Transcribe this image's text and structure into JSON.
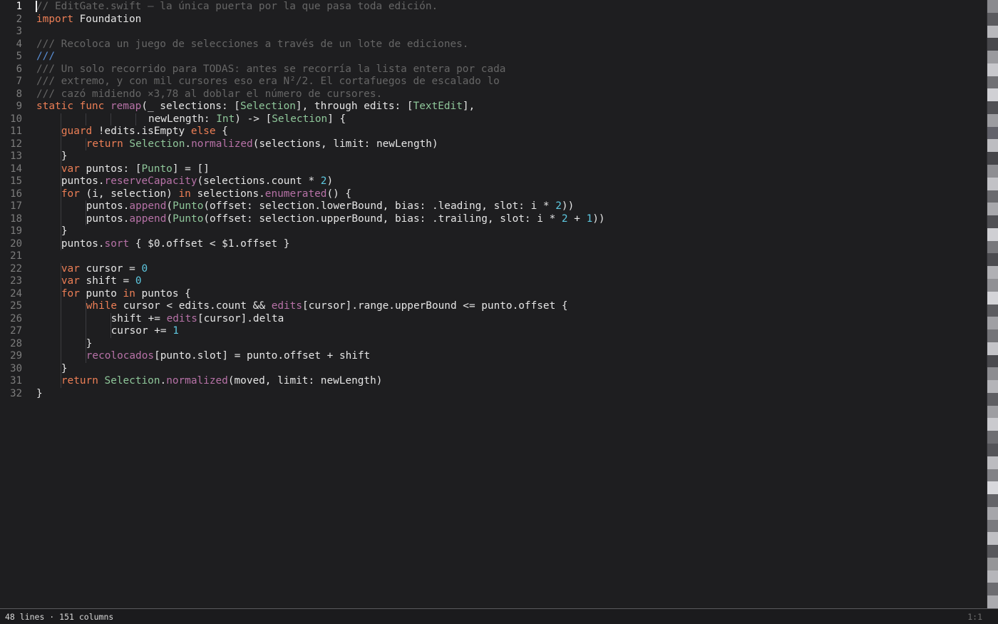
{
  "editor": {
    "current_line": 1,
    "lines": [
      {
        "n": "1",
        "indent": 0,
        "tokens": [
          [
            "cm",
            "// EditGate.swift — la única puerta por la que pasa toda edición."
          ]
        ]
      },
      {
        "n": "2",
        "indent": 0,
        "tokens": [
          [
            "kw",
            "import"
          ],
          [
            "pl",
            " Foundation"
          ]
        ]
      },
      {
        "n": "3",
        "indent": 0,
        "tokens": []
      },
      {
        "n": "4",
        "indent": 0,
        "tokens": [
          [
            "cm",
            "/// Recoloca un juego de selecciones a través de un lote de ediciones."
          ]
        ]
      },
      {
        "n": "5",
        "indent": 0,
        "tokens": [
          [
            "dc",
            "///"
          ]
        ]
      },
      {
        "n": "6",
        "indent": 0,
        "tokens": [
          [
            "cm",
            "/// Un solo recorrido para TODAS: antes se recorría la lista entera por cada"
          ]
        ]
      },
      {
        "n": "7",
        "indent": 0,
        "tokens": [
          [
            "cm",
            "/// extremo, y con mil cursores eso era N²/2. El cortafuegos de escalado lo"
          ]
        ]
      },
      {
        "n": "8",
        "indent": 0,
        "tokens": [
          [
            "cm",
            "/// cazó midiendo ×3,78 al doblar el número de cursores."
          ]
        ]
      },
      {
        "n": "9",
        "indent": 0,
        "tokens": [
          [
            "kw",
            "static"
          ],
          [
            "pl",
            " "
          ],
          [
            "kw",
            "func"
          ],
          [
            "pl",
            " "
          ],
          [
            "fn",
            "remap"
          ],
          [
            "pl",
            "(_ selections: ["
          ],
          [
            "tp",
            "Selection"
          ],
          [
            "pl",
            "], through edits: ["
          ],
          [
            "tp",
            "TextEdit"
          ],
          [
            "pl",
            "],"
          ]
        ]
      },
      {
        "n": "10",
        "indent": 18,
        "tokens": [
          [
            "pl",
            "newLength: "
          ],
          [
            "tp",
            "Int"
          ],
          [
            "pl",
            ") -> ["
          ],
          [
            "tp",
            "Selection"
          ],
          [
            "pl",
            "] {"
          ]
        ]
      },
      {
        "n": "11",
        "indent": 4,
        "tokens": [
          [
            "kw",
            "guard"
          ],
          [
            "pl",
            " !edits.isEmpty "
          ],
          [
            "kw",
            "else"
          ],
          [
            "pl",
            " {"
          ]
        ]
      },
      {
        "n": "12",
        "indent": 8,
        "tokens": [
          [
            "kw",
            "return"
          ],
          [
            "pl",
            " "
          ],
          [
            "tp",
            "Selection"
          ],
          [
            "pl",
            "."
          ],
          [
            "fn",
            "normalized"
          ],
          [
            "pl",
            "(selections, limit: newLength)"
          ]
        ]
      },
      {
        "n": "13",
        "indent": 4,
        "tokens": [
          [
            "pl",
            "}"
          ]
        ]
      },
      {
        "n": "14",
        "indent": 4,
        "tokens": [
          [
            "kw",
            "var"
          ],
          [
            "pl",
            " puntos: ["
          ],
          [
            "tp",
            "Punto"
          ],
          [
            "pl",
            "] = []"
          ]
        ]
      },
      {
        "n": "15",
        "indent": 4,
        "tokens": [
          [
            "pl",
            "puntos."
          ],
          [
            "fn",
            "reserveCapacity"
          ],
          [
            "pl",
            "(selections.count * "
          ],
          [
            "num",
            "2"
          ],
          [
            "pl",
            ")"
          ]
        ]
      },
      {
        "n": "16",
        "indent": 4,
        "tokens": [
          [
            "kw",
            "for"
          ],
          [
            "pl",
            " (i, selection) "
          ],
          [
            "kw",
            "in"
          ],
          [
            "pl",
            " selections."
          ],
          [
            "fn",
            "enumerated"
          ],
          [
            "pl",
            "() {"
          ]
        ]
      },
      {
        "n": "17",
        "indent": 8,
        "tokens": [
          [
            "pl",
            "puntos."
          ],
          [
            "fn",
            "append"
          ],
          [
            "pl",
            "("
          ],
          [
            "tp",
            "Punto"
          ],
          [
            "pl",
            "(offset: selection.lowerBound, bias: .leading, slot: i * "
          ],
          [
            "num",
            "2"
          ],
          [
            "pl",
            "))"
          ]
        ]
      },
      {
        "n": "18",
        "indent": 8,
        "tokens": [
          [
            "pl",
            "puntos."
          ],
          [
            "fn",
            "append"
          ],
          [
            "pl",
            "("
          ],
          [
            "tp",
            "Punto"
          ],
          [
            "pl",
            "(offset: selection.upperBound, bias: .trailing, slot: i * "
          ],
          [
            "num",
            "2"
          ],
          [
            "pl",
            " + "
          ],
          [
            "num",
            "1"
          ],
          [
            "pl",
            "))"
          ]
        ]
      },
      {
        "n": "19",
        "indent": 4,
        "tokens": [
          [
            "pl",
            "}"
          ]
        ]
      },
      {
        "n": "20",
        "indent": 4,
        "tokens": [
          [
            "pl",
            "puntos."
          ],
          [
            "fn",
            "sort"
          ],
          [
            "pl",
            " { $0.offset < $1.offset }"
          ]
        ]
      },
      {
        "n": "21",
        "indent": 0,
        "tokens": []
      },
      {
        "n": "22",
        "indent": 4,
        "tokens": [
          [
            "kw",
            "var"
          ],
          [
            "pl",
            " cursor = "
          ],
          [
            "num",
            "0"
          ]
        ]
      },
      {
        "n": "23",
        "indent": 4,
        "tokens": [
          [
            "kw",
            "var"
          ],
          [
            "pl",
            " shift = "
          ],
          [
            "num",
            "0"
          ]
        ]
      },
      {
        "n": "24",
        "indent": 4,
        "tokens": [
          [
            "kw",
            "for"
          ],
          [
            "pl",
            " punto "
          ],
          [
            "kw",
            "in"
          ],
          [
            "pl",
            " puntos {"
          ]
        ]
      },
      {
        "n": "25",
        "indent": 8,
        "tokens": [
          [
            "kw",
            "while"
          ],
          [
            "pl",
            " cursor < edits.count && "
          ],
          [
            "fn",
            "edits"
          ],
          [
            "pl",
            "[cursor].range.upperBound <= punto.offset {"
          ]
        ]
      },
      {
        "n": "26",
        "indent": 12,
        "tokens": [
          [
            "pl",
            "shift += "
          ],
          [
            "fn",
            "edits"
          ],
          [
            "pl",
            "[cursor].delta"
          ]
        ]
      },
      {
        "n": "27",
        "indent": 12,
        "tokens": [
          [
            "pl",
            "cursor += "
          ],
          [
            "num",
            "1"
          ]
        ]
      },
      {
        "n": "28",
        "indent": 8,
        "tokens": [
          [
            "pl",
            "}"
          ]
        ]
      },
      {
        "n": "29",
        "indent": 8,
        "tokens": [
          [
            "fn",
            "recolocados"
          ],
          [
            "pl",
            "[punto.slot] = punto.offset + shift"
          ]
        ]
      },
      {
        "n": "30",
        "indent": 4,
        "tokens": [
          [
            "pl",
            "}"
          ]
        ]
      },
      {
        "n": "31",
        "indent": 4,
        "tokens": [
          [
            "kw",
            "return"
          ],
          [
            "pl",
            " "
          ],
          [
            "tp",
            "Selection"
          ],
          [
            "pl",
            "."
          ],
          [
            "fn",
            "normalized"
          ],
          [
            "pl",
            "(moved, limit: newLength)"
          ]
        ]
      },
      {
        "n": "32",
        "indent": 0,
        "tokens": [
          [
            "pl",
            "}"
          ]
        ]
      }
    ]
  },
  "status_bar": {
    "info": "48 lines · 151 columns",
    "position": "1:1"
  },
  "colors": {
    "background": "#1e1e20",
    "keyword": "#ed7f56",
    "type": "#8fc79a",
    "function": "#b772a7",
    "number": "#5ec8e0",
    "comment": "#666666",
    "doc_comment": "#5a8fd6",
    "plain": "#e6e6e6"
  },
  "minimap": {
    "shades": [
      "#8a8a8e",
      "#5a5a5e",
      "#b8b8bc",
      "#48484c",
      "#9a9a9e",
      "#c8c8cc",
      "#707074",
      "#d0d0d4",
      "#505054",
      "#9c9ca0",
      "#62626a",
      "#bdbdc1",
      "#46464a",
      "#8e8e92",
      "#c2c2c6",
      "#6a6a6e",
      "#a8a8ac",
      "#505054",
      "#cfcfd3",
      "#78787c",
      "#4c4c50",
      "#b0b0b4",
      "#909094",
      "#d4d4d8",
      "#5c5c60",
      "#a0a0a4",
      "#747478",
      "#c4c4c8",
      "#4a4a4e",
      "#8c8c90",
      "#b4b4b8",
      "#5e5e62",
      "#9e9ea2",
      "#cacace",
      "#6e6e72",
      "#545458",
      "#bcbcc0",
      "#828286",
      "#d8d8dc",
      "#646468",
      "#a6a6aa",
      "#7a7a7e",
      "#c0c0c4",
      "#58585c",
      "#969698",
      "#b6b6ba",
      "#6c6c70",
      "#ababaf"
    ]
  }
}
